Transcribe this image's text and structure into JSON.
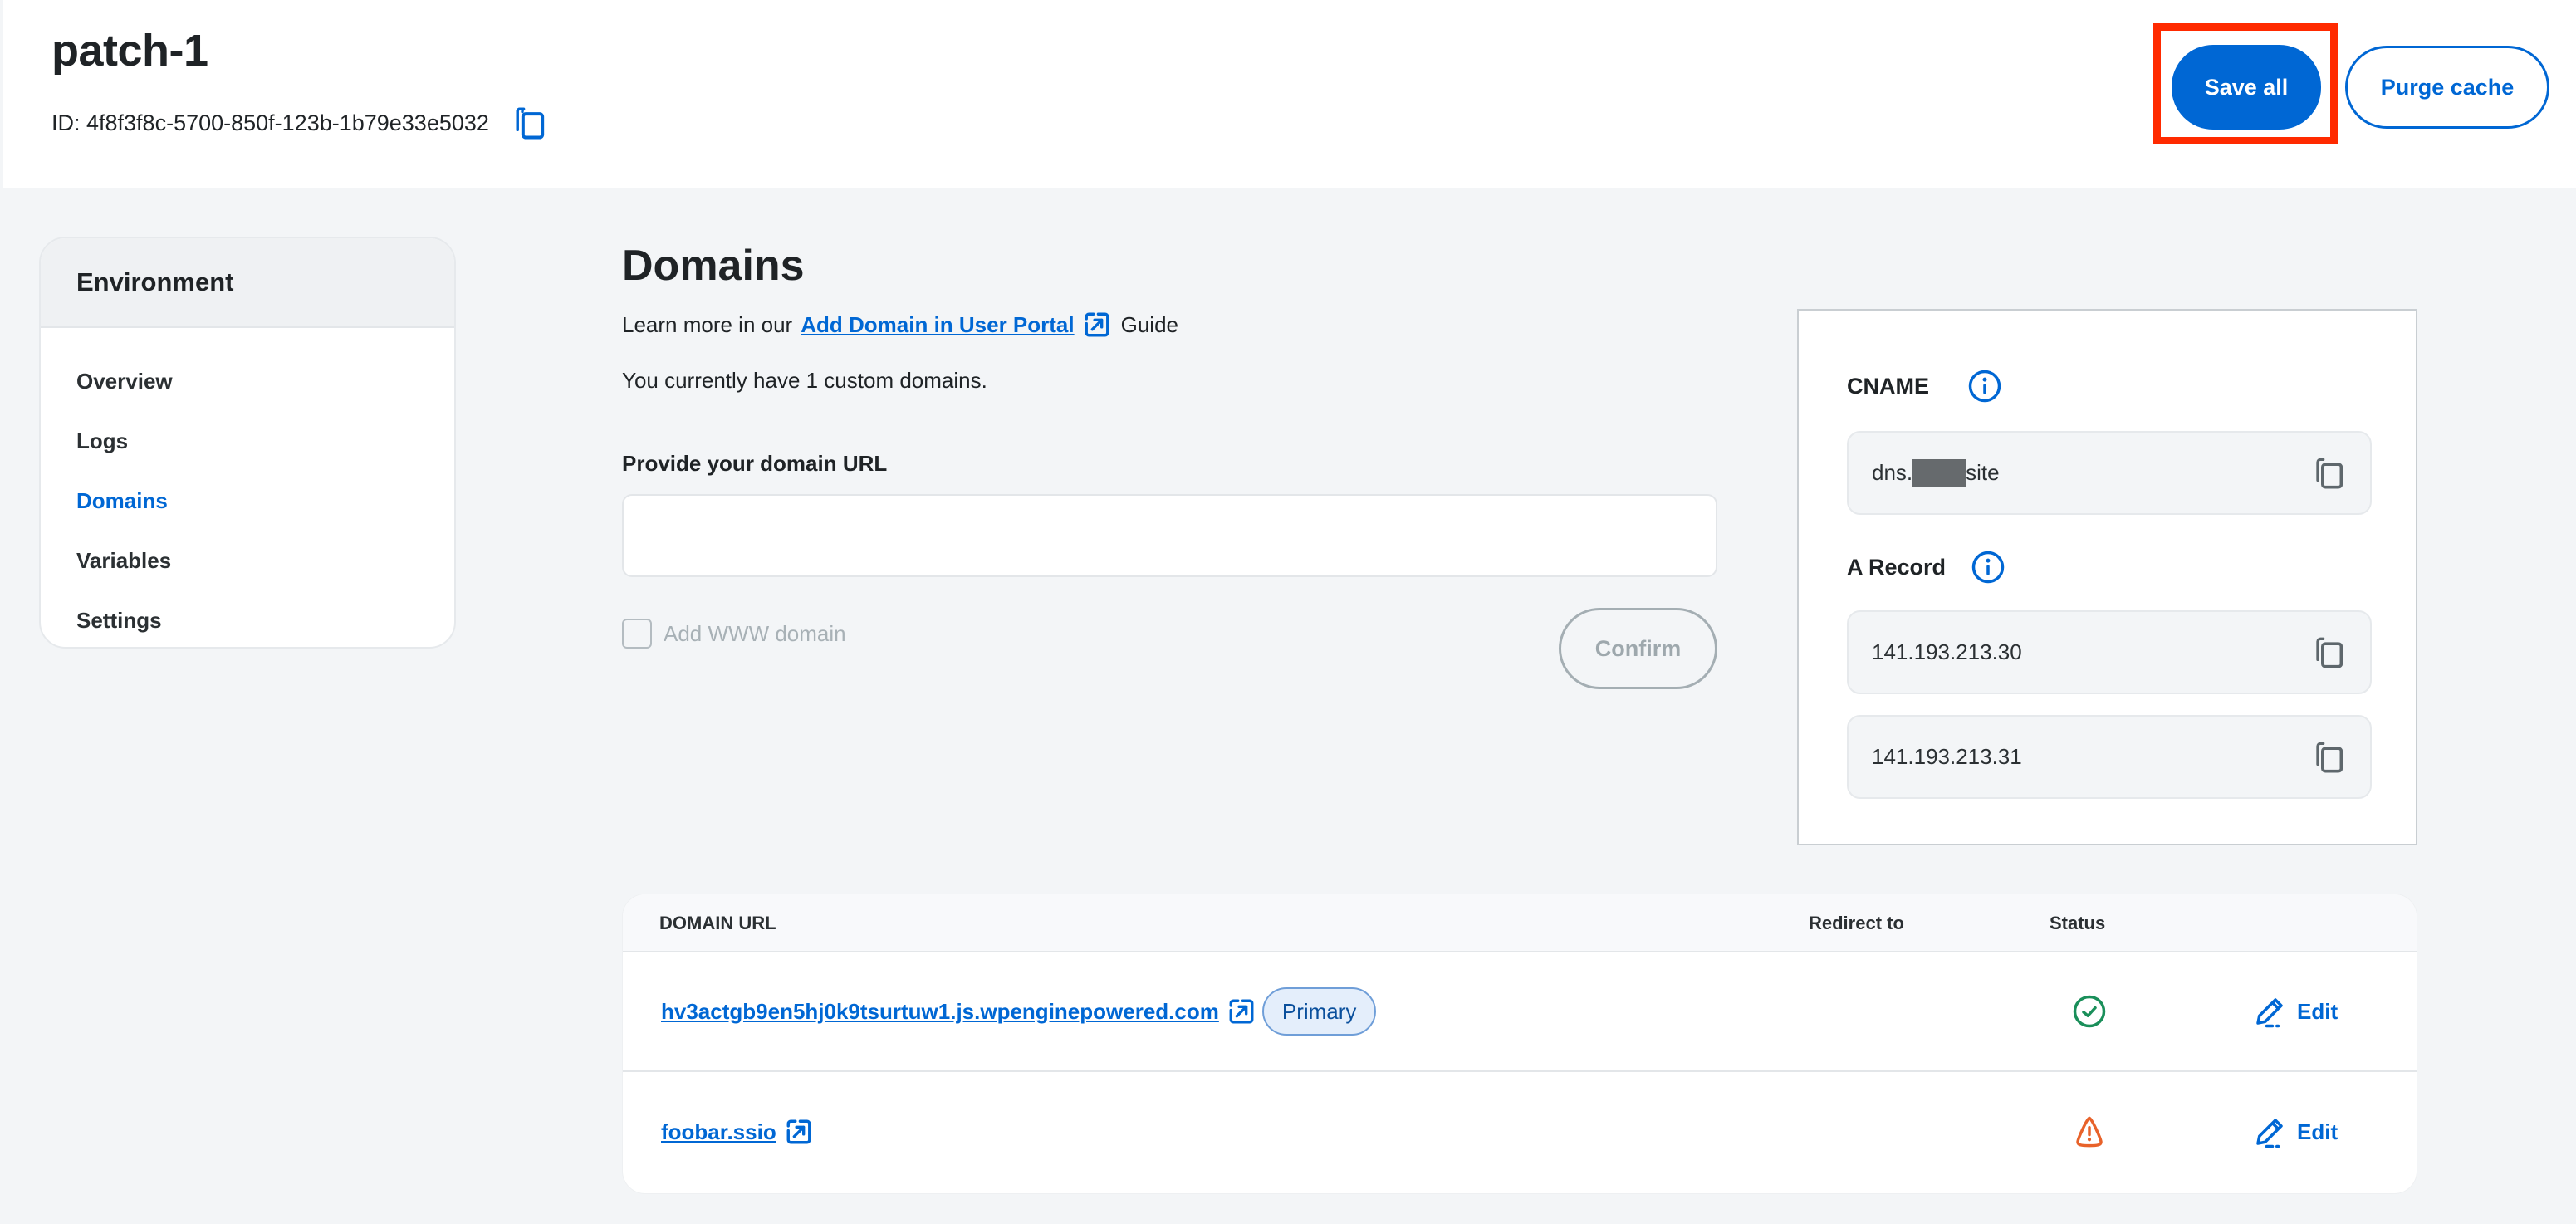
{
  "header": {
    "title": "patch-1",
    "id_label": "ID: 4f8f3f8c-5700-850f-123b-1b79e33e5032",
    "save_all": "Save all",
    "purge_cache": "Purge cache"
  },
  "sidebar": {
    "heading": "Environment",
    "items": [
      {
        "label": "Overview",
        "active": false
      },
      {
        "label": "Logs",
        "active": false
      },
      {
        "label": "Domains",
        "active": true
      },
      {
        "label": "Variables",
        "active": false
      },
      {
        "label": "Settings",
        "active": false
      }
    ]
  },
  "main": {
    "title": "Domains",
    "learn_prefix": "Learn more in our",
    "learn_link": "Add Domain in User Portal",
    "learn_suffix": "Guide",
    "count_text": "You currently have 1 custom domains.",
    "field_label": "Provide your domain URL",
    "field_value": "",
    "www_label": "Add WWW domain",
    "www_checked": false,
    "confirm": "Confirm"
  },
  "dns": {
    "cname_label": "CNAME",
    "cname_prefix": "dns.",
    "cname_suffix": "site",
    "a_record_label": "A Record",
    "a_records": [
      "141.193.213.30",
      "141.193.213.31"
    ]
  },
  "table": {
    "columns": [
      "DOMAIN URL",
      "Redirect to",
      "Status",
      ""
    ],
    "rows": [
      {
        "domain": "hv3actgb9en5hj0k9tsurtuw1.js.wpenginepowered.com",
        "badge": "Primary",
        "redirect": "",
        "status": "ok",
        "action": "Edit"
      },
      {
        "domain": "foobar.ssio",
        "badge": "",
        "redirect": "",
        "status": "warning",
        "action": "Edit"
      }
    ]
  },
  "colors": {
    "accent": "#0067d4",
    "highlight": "#ff2a00",
    "status_ok": "#1a8f5a",
    "status_warning": "#e8622a"
  }
}
